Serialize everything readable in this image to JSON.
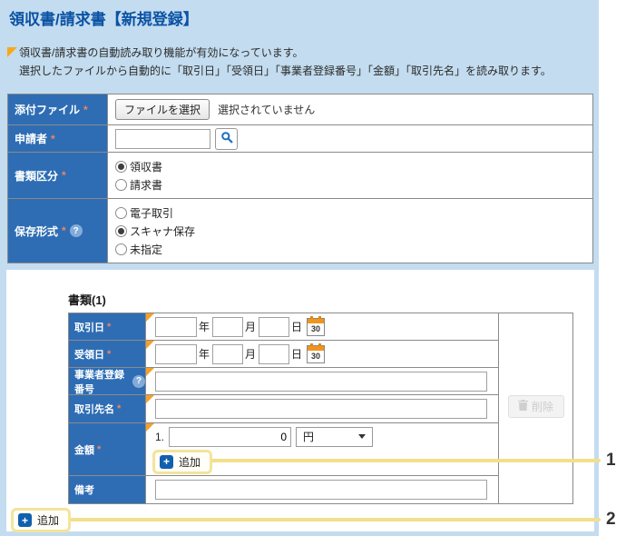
{
  "colors": {
    "page_background": "#C3DCEF",
    "title_text": "#0B52A4",
    "label_cell_background": "#2E6DB4",
    "required_mark": "#F08560",
    "auto_read_marker": "#F2A12C",
    "callout_yellow": "#F2DF8C",
    "add_icon_blue": "#1060AE"
  },
  "header": {
    "title": "領収書/請求書【新規登録】"
  },
  "notice": {
    "line1": "領収書/請求書の自動読み取り機能が有効になっています。",
    "line2": "選択したファイルから自動的に「取引日」「受領日」「事業者登録番号」「金額」「取引先名」を読み取ります。"
  },
  "marks": {
    "required": "*",
    "help": "?",
    "plus": "+"
  },
  "top_form": {
    "attachment": {
      "label": "添付ファイル",
      "button": "ファイルを選択",
      "status": "選択されていません"
    },
    "applicant": {
      "label": "申請者",
      "value": ""
    },
    "doc_class": {
      "label": "書類区分",
      "options": [
        {
          "label": "領収書",
          "selected": true
        },
        {
          "label": "請求書",
          "selected": false
        }
      ]
    },
    "save_format": {
      "label": "保存形式",
      "options": [
        {
          "label": "電子取引",
          "selected": false
        },
        {
          "label": "スキャナ保存",
          "selected": true
        },
        {
          "label": "未指定",
          "selected": false
        }
      ]
    }
  },
  "doc_section": {
    "heading": "書類(1)",
    "transaction_date": {
      "label": "取引日"
    },
    "receipt_date": {
      "label": "受領日"
    },
    "business_number": {
      "label": "事業者登録番号"
    },
    "vendor_name": {
      "label": "取引先名"
    },
    "amount": {
      "label": "金額",
      "index": "1.",
      "value": "0",
      "currency": "円"
    },
    "notes": {
      "label": "備考"
    },
    "date_units": {
      "year": "年",
      "month": "月",
      "day": "日"
    },
    "calendar_day": "30",
    "delete_button": "削除",
    "add_amount_button": "追加",
    "add_document_button": "追加"
  },
  "callouts": {
    "first": "1",
    "second": "2"
  }
}
